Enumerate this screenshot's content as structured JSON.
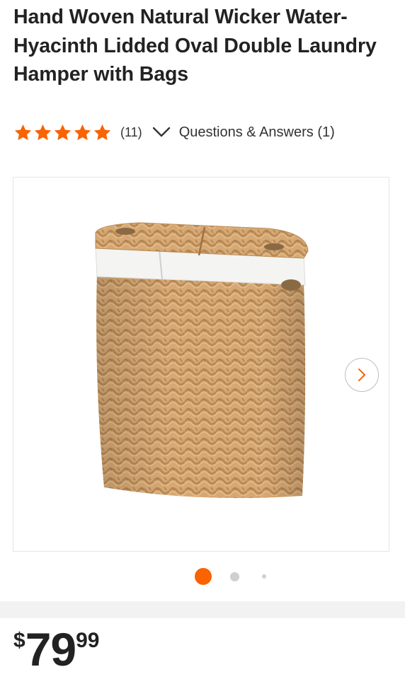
{
  "product": {
    "title": "Hand Woven Natural Wicker Water-Hyacinth Lidded Oval Double Laundry Hamper with Bags",
    "rating": 5,
    "review_count_label": "(11)",
    "qa_label": "Questions & Answers (1)"
  },
  "gallery": {
    "image_alt": "Wicker laundry hamper",
    "next_icon": "chevron-right-icon",
    "dots_count": 3,
    "active_dot": 0
  },
  "price": {
    "currency": "$",
    "dollars": "79",
    "cents": "99"
  },
  "colors": {
    "accent": "#f96302",
    "star": "#f96302"
  }
}
